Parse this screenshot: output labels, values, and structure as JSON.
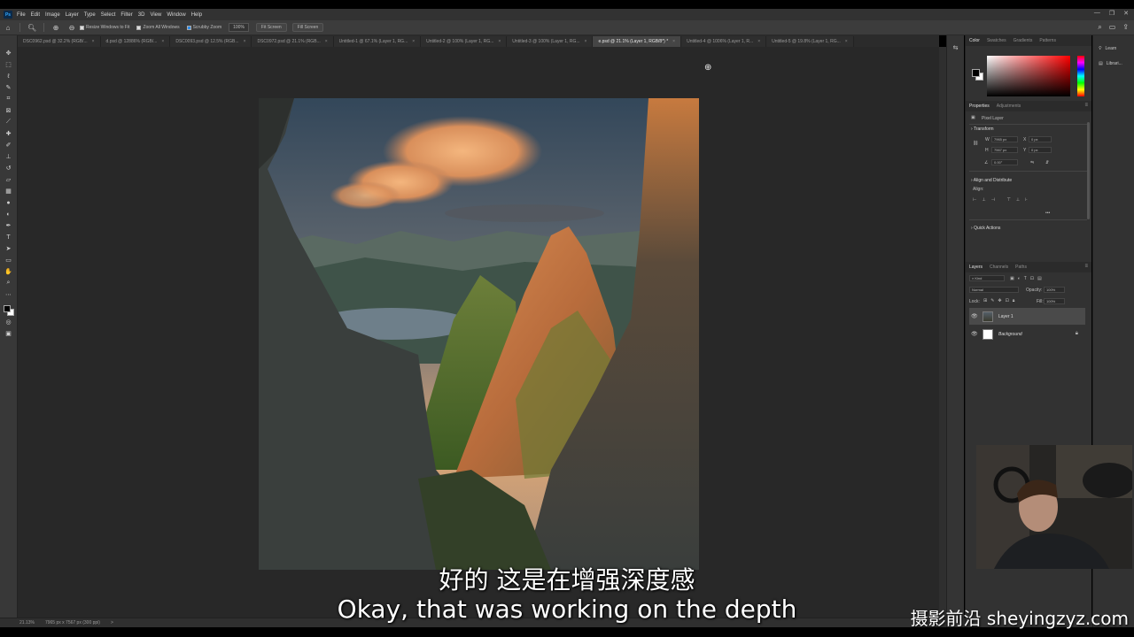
{
  "menu": [
    "File",
    "Edit",
    "Image",
    "Layer",
    "Type",
    "Select",
    "Filter",
    "3D",
    "View",
    "Window",
    "Help"
  ],
  "window_controls": [
    "—",
    "❐",
    "✕"
  ],
  "options": {
    "resize_windows": "Resize Windows to Fit",
    "zoom_all": "Zoom All Windows",
    "scrubby_zoom": "Scrubby Zoom",
    "zoom_value": "100%",
    "fit_screen": "Fit Screen",
    "fill_screen": "Fill Screen"
  },
  "tabs": [
    {
      "label": "DSC0962.psd @ 32.2% (RGB/..."
    },
    {
      "label": "d.psd @ 12886% (RGB/..."
    },
    {
      "label": "DSC0093.psd @ 12.5% (RGB..."
    },
    {
      "label": "DSC0972.psd @ 21.1% (RGB..."
    },
    {
      "label": "Untitled-1 @ 67.1% (Layer 1, RG..."
    },
    {
      "label": "Untitled-2 @ 100% (Layer 1, RG..."
    },
    {
      "label": "Untitled-3 @ 100% (Layer 1, RG..."
    },
    {
      "label": "e.psd @ 21.1% (Layer 1, RGB/8*) *"
    },
    {
      "label": "Untitled-4 @ 1006% (Layer 1, R..."
    },
    {
      "label": "Untitled-5 @ 19.8% (Layer 1, RG..."
    }
  ],
  "tab_close": "×",
  "status": {
    "zoom": "21.13%",
    "dims": "7965 px x 7567 px (300 ppi)",
    "more": ">"
  },
  "color_panel": {
    "tabs": [
      "Color",
      "Swatches",
      "Gradients",
      "Patterns"
    ]
  },
  "properties_panel": {
    "tabs": [
      "Properties",
      "Adjustments"
    ],
    "pixel_layer": "Pixel Layer",
    "transform": "Transform",
    "w_label": "W",
    "w_value": "7965 px",
    "h_label": "H",
    "h_value": "7567 px",
    "x_label": "X",
    "x_value": "0 px",
    "y_label": "Y",
    "y_value": "0 px",
    "angle_value": "0.00°",
    "align_title": "Align and Distribute",
    "align_label": "Align:",
    "more": "•••",
    "quick_actions": "Quick Actions"
  },
  "layers_panel": {
    "tabs": [
      "Layers",
      "Channels",
      "Paths"
    ],
    "kind": "Kind",
    "blend_mode": "Normal",
    "opacity_label": "Opacity:",
    "opacity_value": "100%",
    "lock_label": "Lock:",
    "fill_label": "Fill:",
    "fill_value": "100%",
    "layers": [
      {
        "name": "Layer 1",
        "selected": true
      },
      {
        "name": "Background",
        "locked": true
      }
    ]
  },
  "far_panel": [
    {
      "label": "Learn"
    },
    {
      "label": "Librari..."
    }
  ],
  "subtitle_cn": "好的 这是在增强深度感",
  "subtitle_en": "Okay, that was working on the depth",
  "watermark": "摄影前沿 sheyingzyz.com",
  "colors": {
    "accent": "#31a8ff",
    "panel_bg": "#323232",
    "canvas_bg": "#282828"
  }
}
